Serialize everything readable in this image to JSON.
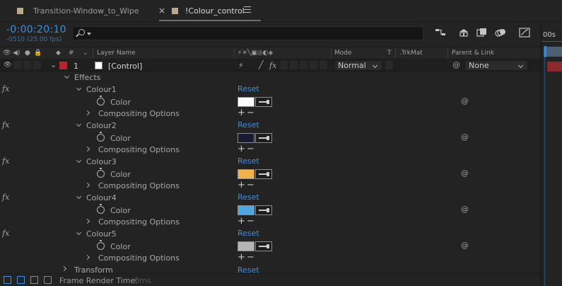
{
  "tabs": [
    {
      "label": "Transition-Window_to_Wipe",
      "active": false
    },
    {
      "label": "!Colour_control",
      "active": true
    }
  ],
  "timecode": {
    "value": "-0:00:20:10",
    "frames": "-0510 (25.00 fps)"
  },
  "search": {
    "placeholder": ""
  },
  "ruler": {
    "label": "00s"
  },
  "columns": {
    "layer_name": "Layer Name",
    "mode": "Mode",
    "t": "T",
    "trkmat": ".TrkMat",
    "parent_link": "Parent & Link"
  },
  "layer": {
    "index": "1",
    "name": "[Control]",
    "mode": "Normal",
    "parent": "None",
    "label_color": "#b3262c"
  },
  "effects_label": "Effects",
  "reset_label": "Reset",
  "color_prop_label": "Color",
  "compositing_label": "Compositing Options",
  "effects": [
    {
      "name": "Colour1",
      "color": "#ffffff"
    },
    {
      "name": "Colour2",
      "color": "#1a1a33"
    },
    {
      "name": "Colour3",
      "color": "#f0b24a"
    },
    {
      "name": "Colour4",
      "color": "#4fa7e2"
    },
    {
      "name": "Colour5",
      "color": "#b5b5b5"
    }
  ],
  "transform": {
    "label": "Transform",
    "reset": "Reset"
  },
  "footer": {
    "label": "Frame Render Time:",
    "value": "0ms"
  },
  "accent_color": "#3d8ee0"
}
